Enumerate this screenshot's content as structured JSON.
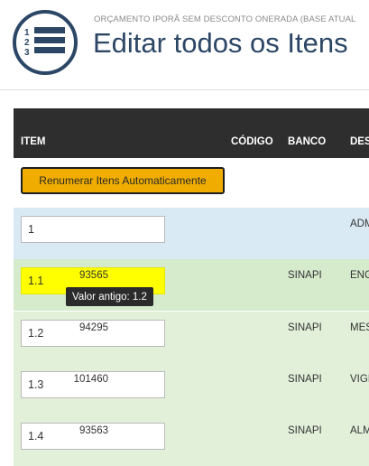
{
  "header": {
    "subtitle": "ORÇAMENTO IPORÃ SEM DESCONTO ONERADA (BASE ATUAL",
    "title": "Editar todos os Itens",
    "logo_icon": "numbered-list-icon",
    "logo_color": "#2c4766"
  },
  "table": {
    "columns": {
      "item": "ITEM",
      "code": "CÓDIGO",
      "bank": "BANCO",
      "desc": "DES"
    },
    "renumber_button": "Renumerar Itens Automaticamente",
    "rows": [
      {
        "item": "1",
        "code": "",
        "bank": "",
        "desc": "ADM"
      },
      {
        "item": "1.1",
        "code": "93565",
        "bank": "SINAPI",
        "desc": "ENG"
      },
      {
        "item": "1.2",
        "code": "94295",
        "bank": "SINAPI",
        "desc": "MES"
      },
      {
        "item": "1.3",
        "code": "101460",
        "bank": "SINAPI",
        "desc": "VIGI"
      },
      {
        "item": "1.4",
        "code": "93563",
        "bank": "SINAPI",
        "desc": "ALM"
      }
    ],
    "tooltip": "Valor antigo: 1.2"
  },
  "colors": {
    "header_bg": "#2e2e2e",
    "button_bg": "#f0ad00",
    "changed_input": "#ffff00",
    "row_group": "#d9eaf5",
    "row_item": "#e2f0da"
  }
}
